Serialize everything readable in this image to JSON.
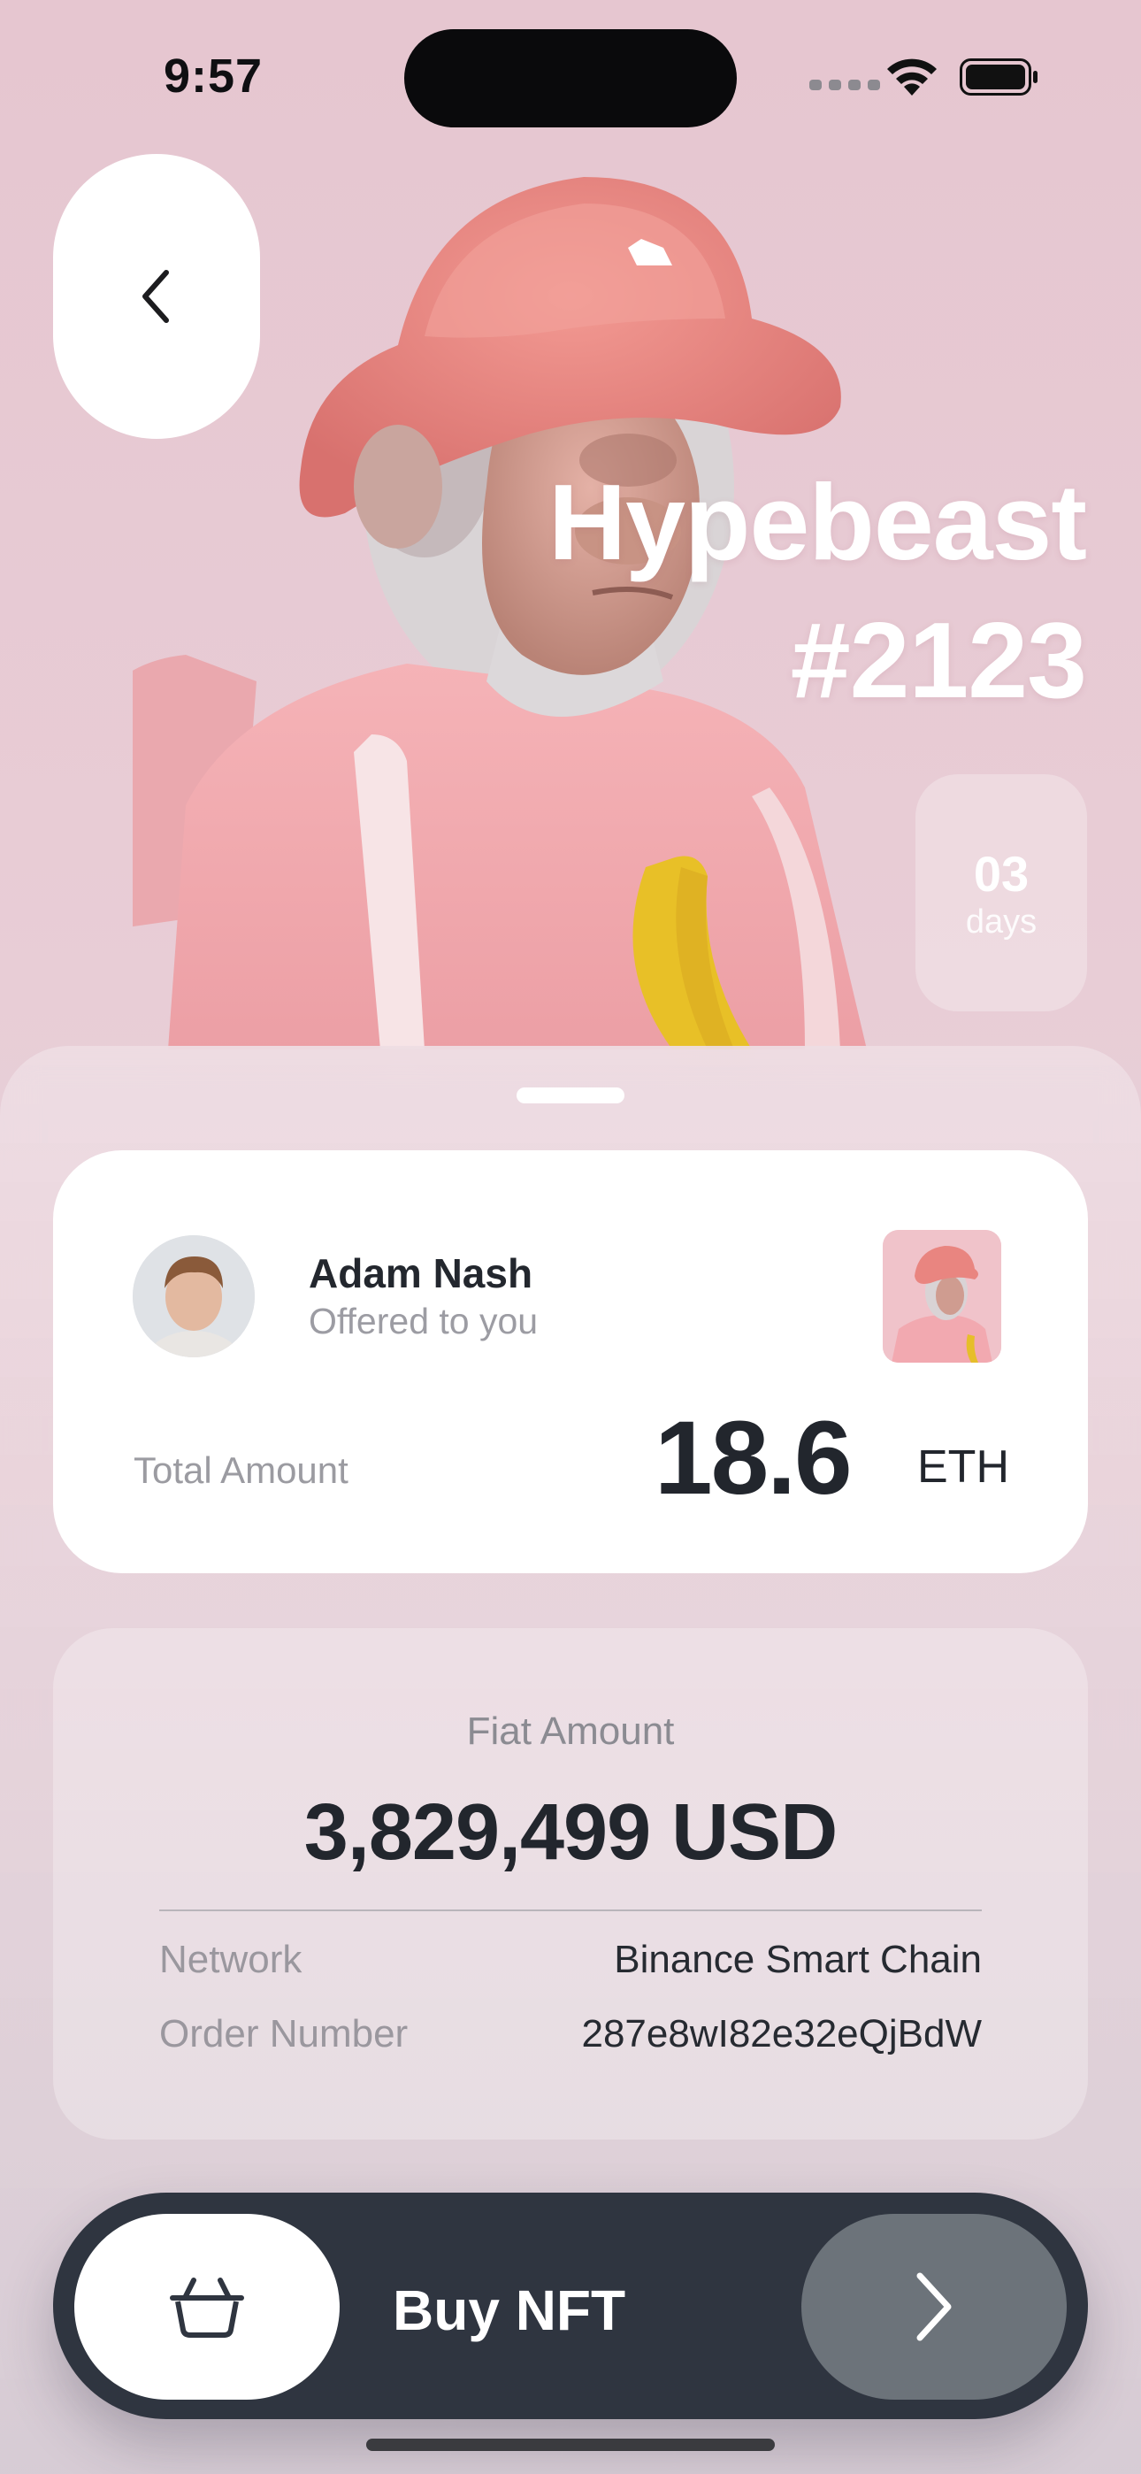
{
  "status_bar": {
    "time": "9:57"
  },
  "nft": {
    "title_line1": "Hypebeast",
    "title_line2": "#2123"
  },
  "countdown": {
    "value": "03",
    "label": "days"
  },
  "offer": {
    "user_name": "Adam Nash",
    "subtitle": "Offered to you",
    "total_label": "Total Amount",
    "amount": "18.6",
    "unit": "ETH"
  },
  "fiat": {
    "label": "Fiat Amount",
    "amount": "3,829,499 USD",
    "rows": [
      {
        "label": "Network",
        "value": "Binance Smart Chain"
      },
      {
        "label": "Order Number",
        "value": "287e8wI82e32eQjBdW"
      }
    ]
  },
  "action": {
    "buy_label": "Buy NFT"
  },
  "icons": {
    "back": "chevron-left-icon",
    "basket": "basket-icon",
    "go": "chevron-right-icon",
    "wifi": "wifi-icon",
    "battery": "battery-icon",
    "signal": "cellular-signal-icon"
  },
  "colors": {
    "background": "#e6c6d0",
    "card": "#ffffff",
    "buy_bar": "#2f3540",
    "go_button": "#6c737a",
    "text_dark": "#22262d",
    "text_muted": "#9b9ba1"
  }
}
